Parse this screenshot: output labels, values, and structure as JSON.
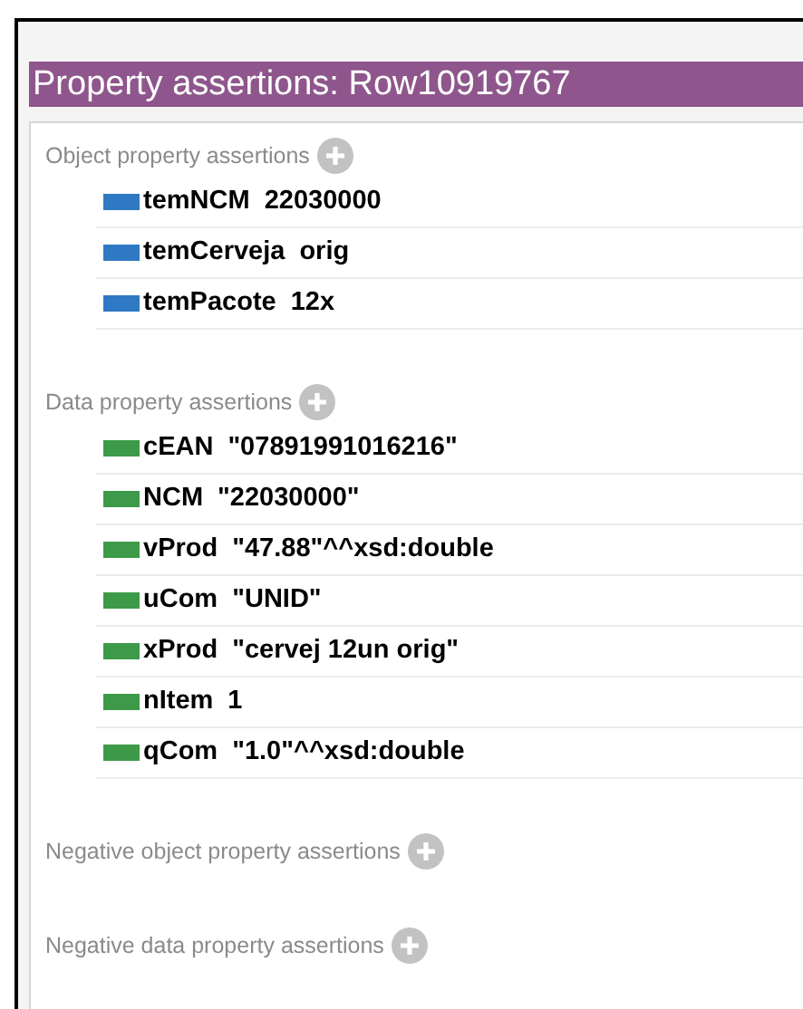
{
  "title": "Property assertions: Row10919767",
  "sections": [
    {
      "label": "Object property assertions",
      "color": "#2f78c4",
      "rows": [
        {
          "property": "temNCM",
          "value": "22030000"
        },
        {
          "property": "temCerveja",
          "value": "orig"
        },
        {
          "property": "temPacote",
          "value": "12x"
        }
      ]
    },
    {
      "label": "Data property assertions",
      "color": "#3c9a48",
      "rows": [
        {
          "property": "cEAN",
          "value": "\"07891991016216\""
        },
        {
          "property": "NCM",
          "value": "\"22030000\""
        },
        {
          "property": "vProd",
          "value": "\"47.88\"^^xsd:double"
        },
        {
          "property": "uCom",
          "value": "\"UNID\""
        },
        {
          "property": "xProd",
          "value": "\"cervej 12un orig\""
        },
        {
          "property": "nItem",
          "value": "1"
        },
        {
          "property": "qCom",
          "value": "\"1.0\"^^xsd:double"
        }
      ]
    },
    {
      "label": "Negative object property assertions"
    },
    {
      "label": "Negative data property assertions"
    }
  ]
}
